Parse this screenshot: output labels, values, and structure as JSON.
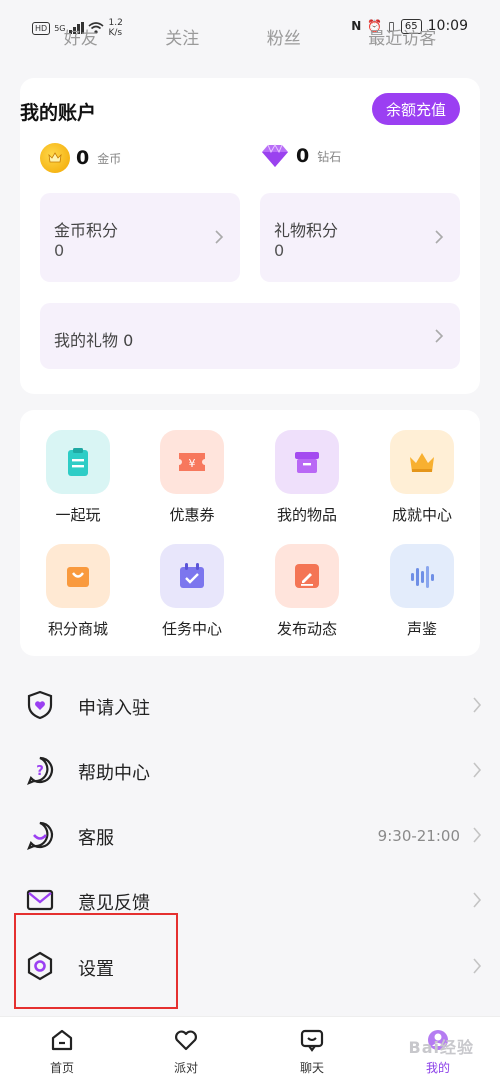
{
  "status_bar": {
    "hd": "HD",
    "net": "5G",
    "speed_value": "1.2",
    "speed_unit": "K/s",
    "battery": "65",
    "time": "10:09"
  },
  "top_tabs": [
    "好友",
    "关注",
    "粉丝",
    "最近访客"
  ],
  "account": {
    "title": "我的账户",
    "recharge_label": "余额充值",
    "coins_value": "0",
    "coins_unit": "金币",
    "diamonds_value": "0",
    "diamonds_unit": "钻石",
    "coin_points_label": "金币积分",
    "coin_points_value": "0",
    "gift_points_label": "礼物积分",
    "gift_points_value": "0",
    "my_gifts_label": "我的礼物 0"
  },
  "grid": [
    {
      "label": "一起玩",
      "icon": "clipboard-icon",
      "bg": "#d9f5f4",
      "fg": "#2ecdc6"
    },
    {
      "label": "优惠券",
      "icon": "coupon-icon",
      "bg": "#ffe4dc",
      "fg": "#f7785d"
    },
    {
      "label": "我的物品",
      "icon": "box-icon",
      "bg": "#efe0fb",
      "fg": "#a44bf0"
    },
    {
      "label": "成就中心",
      "icon": "crown-icon",
      "bg": "#ffefd6",
      "fg": "#f8b030"
    },
    {
      "label": "积分商城",
      "icon": "shopping-bag-icon",
      "bg": "#ffe9d3",
      "fg": "#f99a3e"
    },
    {
      "label": "任务中心",
      "icon": "calendar-check-icon",
      "bg": "#e8e6fb",
      "fg": "#7c76ee"
    },
    {
      "label": "发布动态",
      "icon": "edit-icon",
      "bg": "#ffe4dc",
      "fg": "#f47555"
    },
    {
      "label": "声鉴",
      "icon": "sound-wave-icon",
      "bg": "#e3ecfb",
      "fg": "#6f8fe6"
    }
  ],
  "menu": [
    {
      "label": "申请入驻",
      "icon": "shield-heart-icon",
      "extra": ""
    },
    {
      "label": "帮助中心",
      "icon": "help-icon",
      "extra": ""
    },
    {
      "label": "客服",
      "icon": "chat-support-icon",
      "extra": "9:30-21:00"
    },
    {
      "label": "意见反馈",
      "icon": "mail-icon",
      "extra": ""
    },
    {
      "label": "设置",
      "icon": "settings-hex-icon",
      "extra": ""
    }
  ],
  "bottom_nav": [
    {
      "label": "首页",
      "icon": "home-icon"
    },
    {
      "label": "派对",
      "icon": "heart-icon"
    },
    {
      "label": "聊天",
      "icon": "chat-icon"
    },
    {
      "label": "我的",
      "icon": "profile-icon"
    }
  ],
  "watermark": "Bai经验",
  "colors": {
    "accent": "#9b3ff2",
    "highlight": "#e53030"
  }
}
